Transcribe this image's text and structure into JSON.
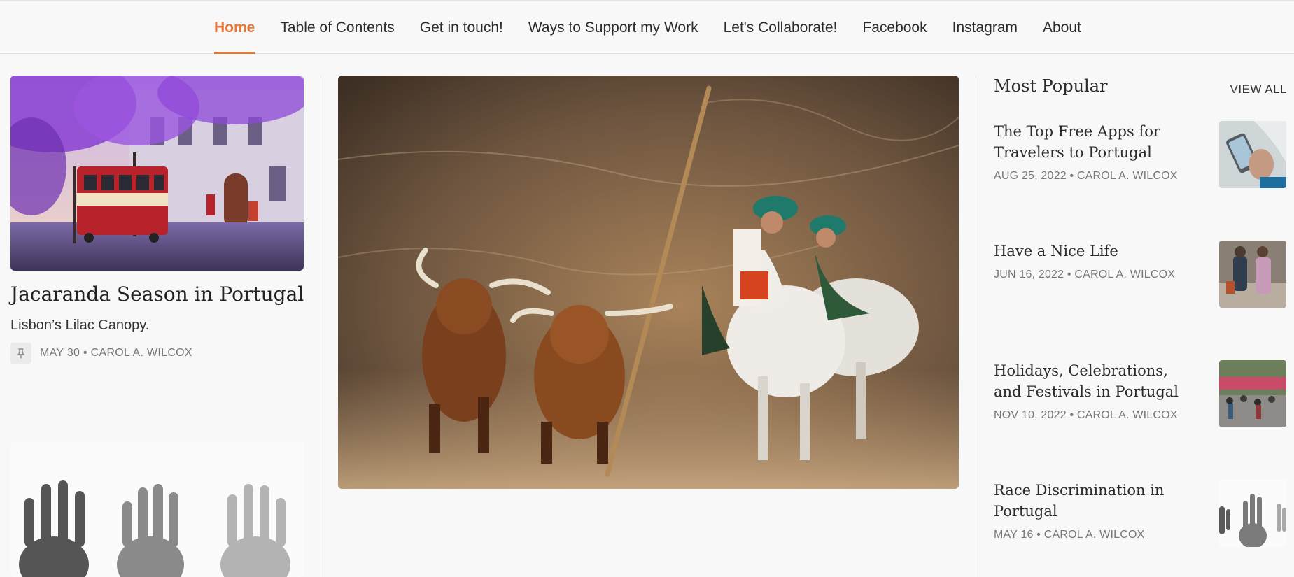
{
  "nav": {
    "items": [
      {
        "label": "Home",
        "active": true
      },
      {
        "label": "Table of Contents"
      },
      {
        "label": "Get in touch!"
      },
      {
        "label": "Ways to Support my Work"
      },
      {
        "label": "Let's Collaborate!"
      },
      {
        "label": "Facebook"
      },
      {
        "label": "Instagram"
      },
      {
        "label": "About"
      }
    ]
  },
  "featured": {
    "title": "Jacaranda Season in Portugal",
    "subtitle": "Lisbon’s Lilac Canopy.",
    "meta": "MAY 30 • CAROL A. WILCOX",
    "pin_icon": "pin-icon"
  },
  "popular": {
    "title": "Most Popular",
    "view_all": "VIEW ALL",
    "items": [
      {
        "title": "The Top Free Apps for Travelers to Portugal",
        "meta": "AUG 25, 2022 • CAROL A. WILCOX"
      },
      {
        "title": "Have a Nice Life",
        "meta": "JUN 16, 2022 • CAROL A. WILCOX"
      },
      {
        "title": "Holidays, Celebrations, and Festivals in Portugal",
        "meta": "NOV 10, 2022 • CAROL A. WILCOX"
      },
      {
        "title": "Race Discrimination in Portugal",
        "meta": "MAY 16 • CAROL A. WILCOX"
      }
    ]
  },
  "colors": {
    "accent": "#e8763a"
  }
}
